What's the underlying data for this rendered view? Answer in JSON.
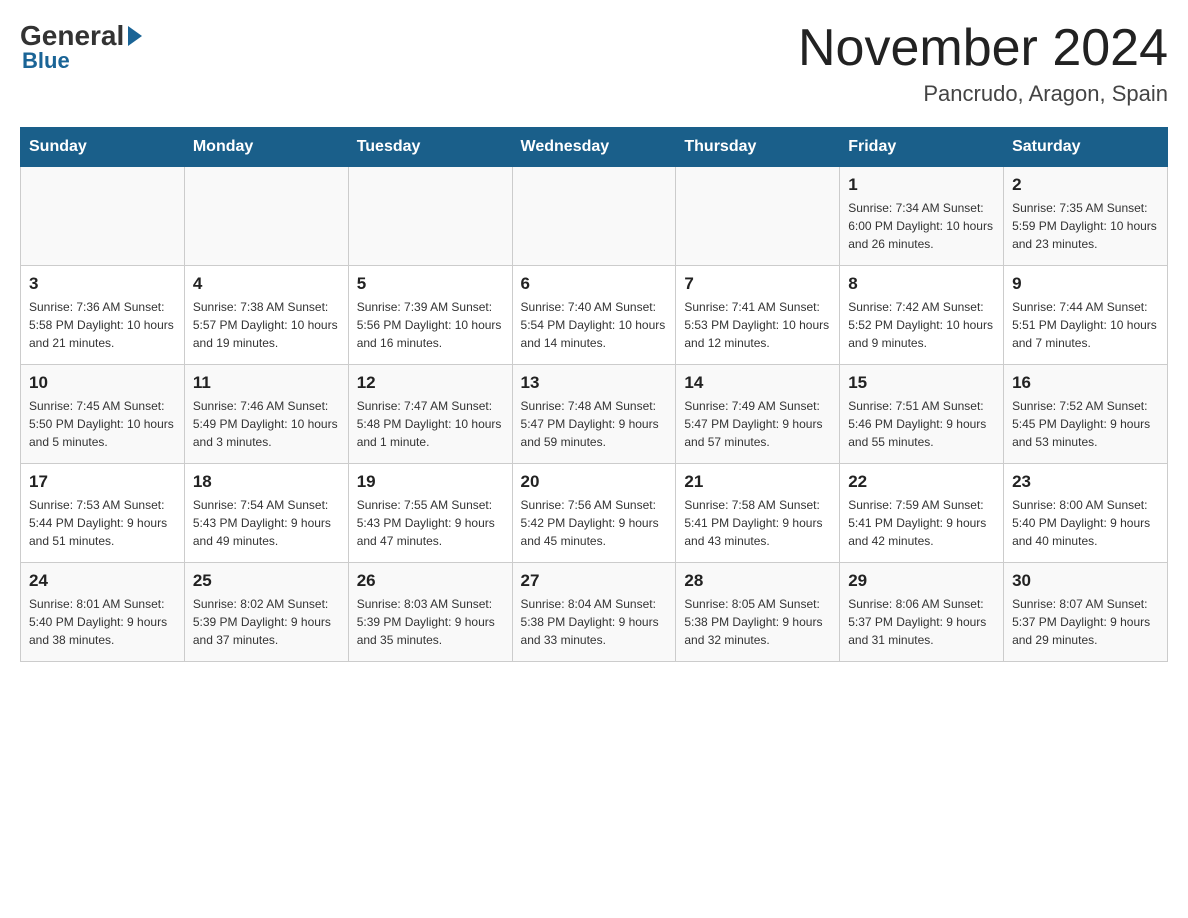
{
  "header": {
    "logo_general": "General",
    "logo_blue": "Blue",
    "title": "November 2024",
    "subtitle": "Pancrudo, Aragon, Spain"
  },
  "weekdays": [
    "Sunday",
    "Monday",
    "Tuesday",
    "Wednesday",
    "Thursday",
    "Friday",
    "Saturday"
  ],
  "weeks": [
    [
      {
        "day": "",
        "info": ""
      },
      {
        "day": "",
        "info": ""
      },
      {
        "day": "",
        "info": ""
      },
      {
        "day": "",
        "info": ""
      },
      {
        "day": "",
        "info": ""
      },
      {
        "day": "1",
        "info": "Sunrise: 7:34 AM\nSunset: 6:00 PM\nDaylight: 10 hours and 26 minutes."
      },
      {
        "day": "2",
        "info": "Sunrise: 7:35 AM\nSunset: 5:59 PM\nDaylight: 10 hours and 23 minutes."
      }
    ],
    [
      {
        "day": "3",
        "info": "Sunrise: 7:36 AM\nSunset: 5:58 PM\nDaylight: 10 hours and 21 minutes."
      },
      {
        "day": "4",
        "info": "Sunrise: 7:38 AM\nSunset: 5:57 PM\nDaylight: 10 hours and 19 minutes."
      },
      {
        "day": "5",
        "info": "Sunrise: 7:39 AM\nSunset: 5:56 PM\nDaylight: 10 hours and 16 minutes."
      },
      {
        "day": "6",
        "info": "Sunrise: 7:40 AM\nSunset: 5:54 PM\nDaylight: 10 hours and 14 minutes."
      },
      {
        "day": "7",
        "info": "Sunrise: 7:41 AM\nSunset: 5:53 PM\nDaylight: 10 hours and 12 minutes."
      },
      {
        "day": "8",
        "info": "Sunrise: 7:42 AM\nSunset: 5:52 PM\nDaylight: 10 hours and 9 minutes."
      },
      {
        "day": "9",
        "info": "Sunrise: 7:44 AM\nSunset: 5:51 PM\nDaylight: 10 hours and 7 minutes."
      }
    ],
    [
      {
        "day": "10",
        "info": "Sunrise: 7:45 AM\nSunset: 5:50 PM\nDaylight: 10 hours and 5 minutes."
      },
      {
        "day": "11",
        "info": "Sunrise: 7:46 AM\nSunset: 5:49 PM\nDaylight: 10 hours and 3 minutes."
      },
      {
        "day": "12",
        "info": "Sunrise: 7:47 AM\nSunset: 5:48 PM\nDaylight: 10 hours and 1 minute."
      },
      {
        "day": "13",
        "info": "Sunrise: 7:48 AM\nSunset: 5:47 PM\nDaylight: 9 hours and 59 minutes."
      },
      {
        "day": "14",
        "info": "Sunrise: 7:49 AM\nSunset: 5:47 PM\nDaylight: 9 hours and 57 minutes."
      },
      {
        "day": "15",
        "info": "Sunrise: 7:51 AM\nSunset: 5:46 PM\nDaylight: 9 hours and 55 minutes."
      },
      {
        "day": "16",
        "info": "Sunrise: 7:52 AM\nSunset: 5:45 PM\nDaylight: 9 hours and 53 minutes."
      }
    ],
    [
      {
        "day": "17",
        "info": "Sunrise: 7:53 AM\nSunset: 5:44 PM\nDaylight: 9 hours and 51 minutes."
      },
      {
        "day": "18",
        "info": "Sunrise: 7:54 AM\nSunset: 5:43 PM\nDaylight: 9 hours and 49 minutes."
      },
      {
        "day": "19",
        "info": "Sunrise: 7:55 AM\nSunset: 5:43 PM\nDaylight: 9 hours and 47 minutes."
      },
      {
        "day": "20",
        "info": "Sunrise: 7:56 AM\nSunset: 5:42 PM\nDaylight: 9 hours and 45 minutes."
      },
      {
        "day": "21",
        "info": "Sunrise: 7:58 AM\nSunset: 5:41 PM\nDaylight: 9 hours and 43 minutes."
      },
      {
        "day": "22",
        "info": "Sunrise: 7:59 AM\nSunset: 5:41 PM\nDaylight: 9 hours and 42 minutes."
      },
      {
        "day": "23",
        "info": "Sunrise: 8:00 AM\nSunset: 5:40 PM\nDaylight: 9 hours and 40 minutes."
      }
    ],
    [
      {
        "day": "24",
        "info": "Sunrise: 8:01 AM\nSunset: 5:40 PM\nDaylight: 9 hours and 38 minutes."
      },
      {
        "day": "25",
        "info": "Sunrise: 8:02 AM\nSunset: 5:39 PM\nDaylight: 9 hours and 37 minutes."
      },
      {
        "day": "26",
        "info": "Sunrise: 8:03 AM\nSunset: 5:39 PM\nDaylight: 9 hours and 35 minutes."
      },
      {
        "day": "27",
        "info": "Sunrise: 8:04 AM\nSunset: 5:38 PM\nDaylight: 9 hours and 33 minutes."
      },
      {
        "day": "28",
        "info": "Sunrise: 8:05 AM\nSunset: 5:38 PM\nDaylight: 9 hours and 32 minutes."
      },
      {
        "day": "29",
        "info": "Sunrise: 8:06 AM\nSunset: 5:37 PM\nDaylight: 9 hours and 31 minutes."
      },
      {
        "day": "30",
        "info": "Sunrise: 8:07 AM\nSunset: 5:37 PM\nDaylight: 9 hours and 29 minutes."
      }
    ]
  ]
}
